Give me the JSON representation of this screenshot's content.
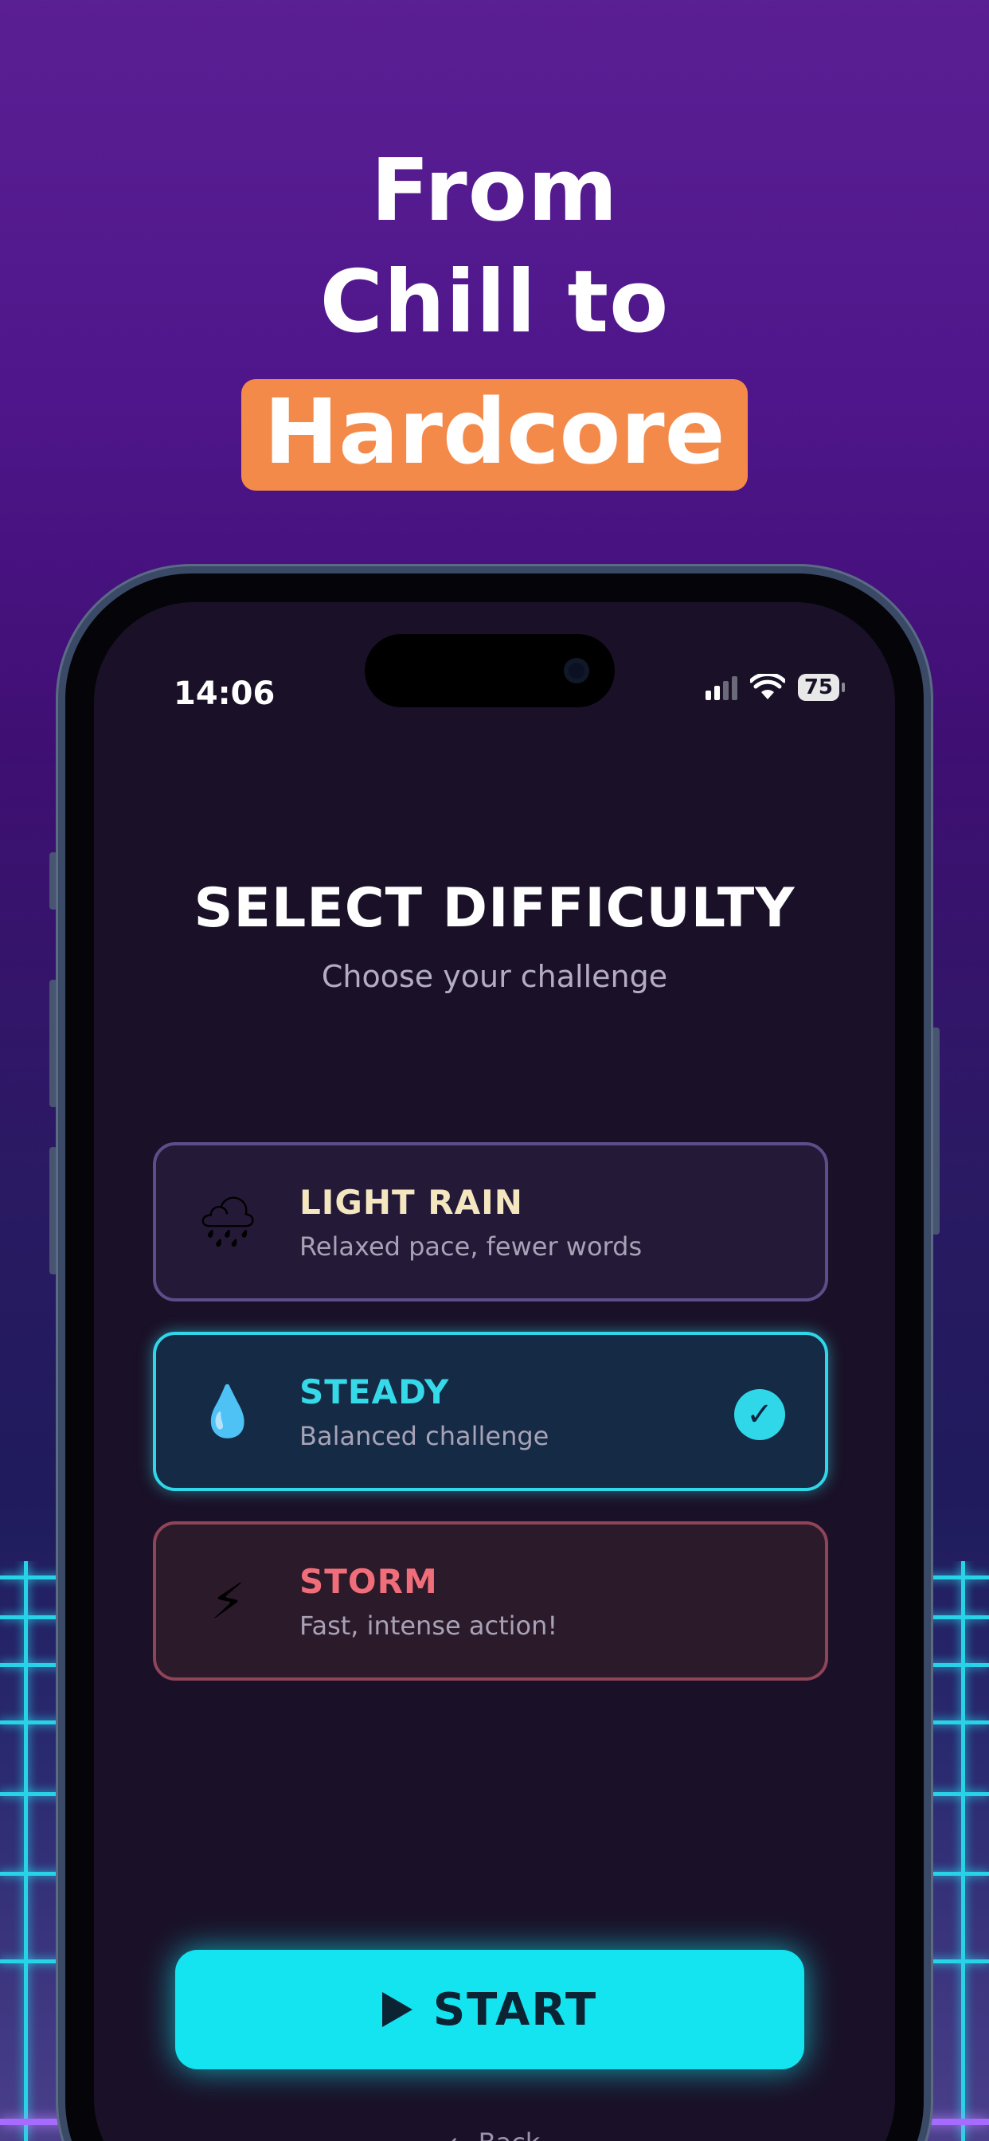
{
  "headline": {
    "line1": "From",
    "line2": "Chill to",
    "highlight": "Hardcore",
    "highlight_color": "#f48a4a"
  },
  "status_bar": {
    "time": "14:06",
    "battery": "75",
    "icons": [
      "cellular-signal-icon",
      "wifi-icon",
      "battery-icon"
    ]
  },
  "screen": {
    "title": "SELECT DIFFICULTY",
    "subtitle": "Choose your challenge",
    "options": [
      {
        "name": "LIGHT RAIN",
        "description": "Relaxed pace, fewer words",
        "icon": "cloud-rain-icon",
        "glyph": "🌧",
        "accent": "#f4e7bf",
        "selected": false
      },
      {
        "name": "STEADY",
        "description": "Balanced challenge",
        "icon": "droplet-icon",
        "glyph": "💧",
        "accent": "#36d9e8",
        "selected": true
      },
      {
        "name": "STORM",
        "description": "Fast, intense action!",
        "icon": "lightning-icon",
        "glyph": "⚡",
        "accent": "#f06d7a",
        "selected": false
      }
    ],
    "selected_check": "✓",
    "start_button": {
      "label": "START",
      "icon": "play-icon",
      "color": "#14e3f0"
    },
    "bottom_hint": "← Back"
  }
}
